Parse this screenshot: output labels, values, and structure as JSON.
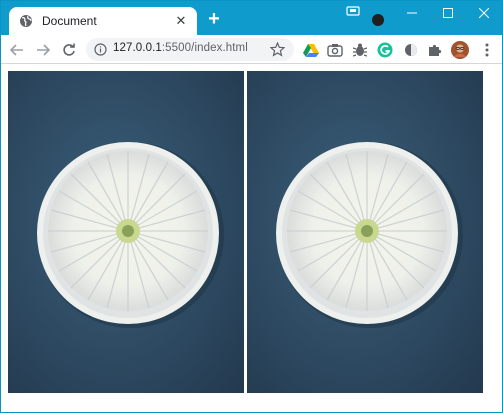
{
  "browser": {
    "tab": {
      "title": "Document"
    },
    "address_bar": {
      "host": "127.0.0.1",
      "rest": ":5500/index.html"
    },
    "accent_color": "#0f9bcc"
  },
  "toolbar": {
    "icons": [
      "back-icon",
      "forward-icon",
      "reload-icon",
      "info-icon",
      "star-icon",
      "google-drive-icon",
      "camera-icon",
      "bug-icon",
      "grammarly-icon",
      "dark-mode-icon",
      "puzzle-icon",
      "profile-avatar",
      "menu-icon"
    ]
  },
  "page": {
    "images": [
      {
        "subject": "white chrysanthemum flower on a white plate over blue fabric"
      },
      {
        "subject": "white chrysanthemum flower on a white plate over blue fabric"
      }
    ]
  }
}
